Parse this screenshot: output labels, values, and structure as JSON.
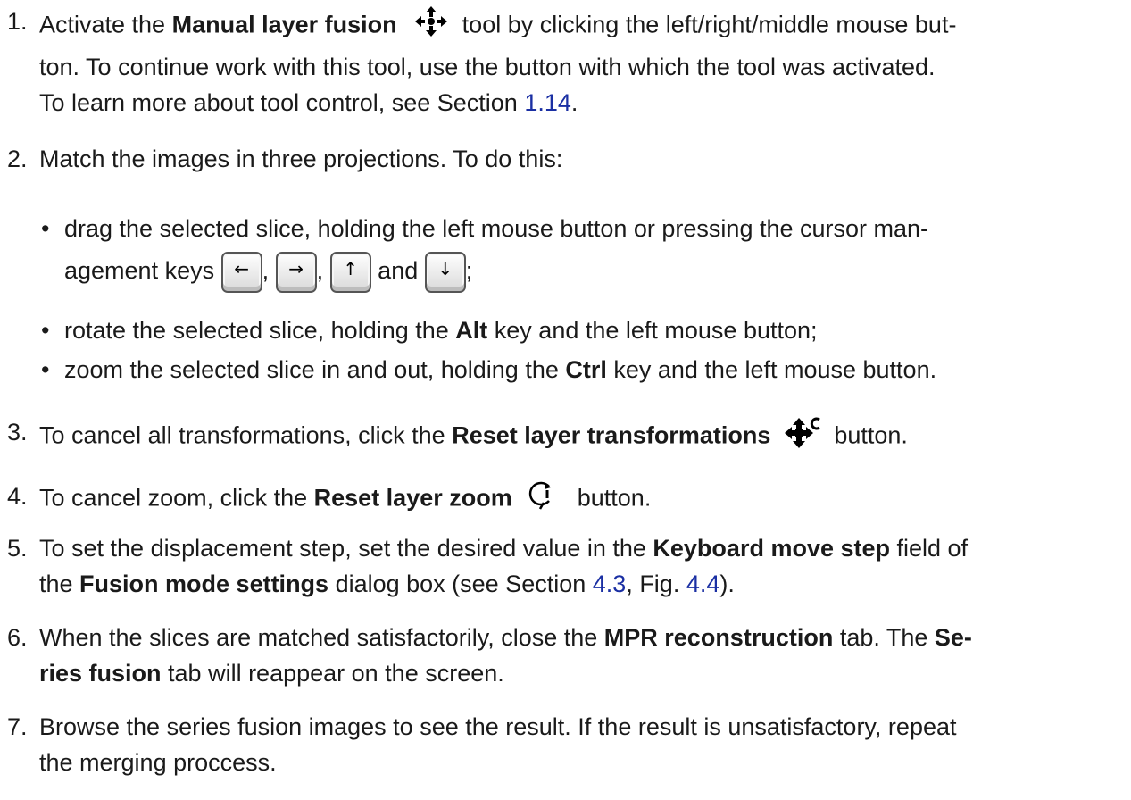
{
  "steps": {
    "s1": {
      "num": "1.",
      "t1": "Activate the ",
      "b1": "Manual layer fusion",
      "t2": " tool by clicking the left/right/middle mouse but-",
      "line2": "ton.  To continue work with this tool, use the button with which the tool was activated.",
      "t3": "To learn more about tool control, see Section ",
      "link": "1.14",
      "t4": "."
    },
    "s2": {
      "num": "2.",
      "text": "Match the images in three projections. To do this:",
      "bullets": {
        "b1": {
          "line1": "drag the selected slice, holding the left mouse button or pressing the cursor man-",
          "t1": "agement keys ",
          "sep1": ",",
          "sep2": ",",
          "and": "and",
          "end": ";"
        },
        "b2": {
          "t1": "rotate the selected slice, holding the ",
          "b": "Alt",
          "t2": " key and the left mouse button;"
        },
        "b3": {
          "t1": "zoom the selected slice in and out, holding the ",
          "b": "Ctrl",
          "t2": " key and the left mouse button."
        }
      },
      "keys": {
        "left": "←",
        "right": "→",
        "up": "↑",
        "down": "↓"
      }
    },
    "s3": {
      "num": "3.",
      "t1": "To cancel all transformations, click the ",
      "b1": "Reset layer transformations",
      "t2": " button."
    },
    "s4": {
      "num": "4.",
      "t1": "To cancel zoom, click the ",
      "b1": "Reset layer zoom",
      "t2": " button."
    },
    "s5": {
      "num": "5.",
      "t1": "To set the displacement step, set the desired value in the ",
      "b1": "Keyboard move step",
      "t2": " field of",
      "t3": "the ",
      "b2": "Fusion mode settings",
      "t4": " dialog box (see Section ",
      "link1": "4.3",
      "t5": ", Fig. ",
      "link2": "4.4",
      "t6": ")."
    },
    "s6": {
      "num": "6.",
      "t1": "When the slices are matched satisfactorily, close the ",
      "b1": "MPR reconstruction",
      "t2": " tab. The ",
      "b2": "Se-",
      "b3": "ries fusion",
      "t3": " tab will reappear on the screen."
    },
    "s7": {
      "num": "7.",
      "line1": "Browse the series fusion images to see the result. If the result is unsatisfactory, repeat",
      "line2": "the merging proccess."
    }
  },
  "colors": {
    "text": "#1a1a1a",
    "link": "#1a2fa3",
    "icon": "#000000"
  },
  "icons": [
    "move-arrows-icon",
    "reset-transform-icon",
    "reset-zoom-icon"
  ]
}
